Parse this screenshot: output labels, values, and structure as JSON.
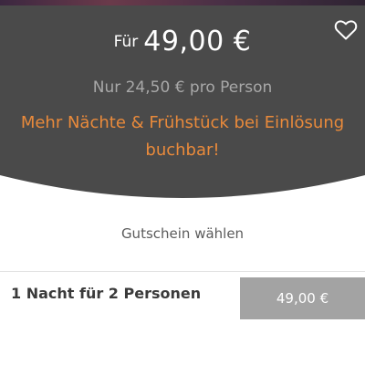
{
  "header": {
    "price_prefix": "Für",
    "price_value": "49,00 €",
    "per_person": "Nur 24,50 € pro Person",
    "promo": "Mehr Nächte & Frühstück bei Einlösung buchbar!",
    "favorite_icon": "heart-outline-icon"
  },
  "voucher_section": {
    "heading": "Gutschein wählen",
    "options": [
      {
        "title": "1 Nacht für 2 Personen",
        "price": "49,00 €"
      }
    ]
  },
  "colors": {
    "panel_bg": "#4a4a4a",
    "promo_text": "#e98a3b",
    "muted_text": "#a8a8a8",
    "price_button_bg": "#a3a3a3"
  }
}
